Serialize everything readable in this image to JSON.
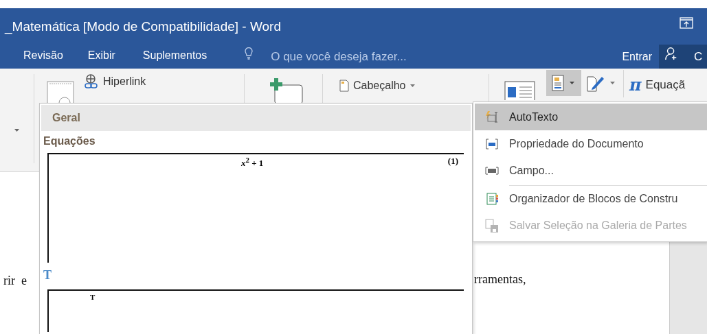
{
  "window": {
    "title": "_Matemática [Modo de Compatibilidade] - Word"
  },
  "tabs": [
    {
      "label": "Revisão",
      "selected": false
    },
    {
      "label": "Exibir",
      "selected": false
    },
    {
      "label": "Suplementos",
      "selected": false
    }
  ],
  "tell_me": {
    "placeholder": "O que você deseja fazer..."
  },
  "account": {
    "sign_in": "Entrar",
    "share": "C"
  },
  "ribbon": {
    "hyperlink": "Hiperlink",
    "header": "Cabeçalho",
    "quick_parts_pressed": true,
    "equation_glyph": "π",
    "equation": "Equaçã"
  },
  "document": {
    "line_start": "rir  e",
    "line_end": "rramentas,"
  },
  "gallery": {
    "header": "Geral",
    "sections": [
      {
        "title": "Equações",
        "preview": "*x*$^{2}$ + 1",
        "number": "(1)"
      },
      {
        "title": "T",
        "preview": "T"
      }
    ]
  },
  "menu": {
    "items": [
      {
        "kind": "autotext",
        "label": "AutoTexto",
        "selected": true,
        "disabled": false,
        "separator_before": false
      },
      {
        "kind": "property",
        "label": "Propriedade do Documento",
        "selected": false,
        "disabled": false,
        "separator_before": false
      },
      {
        "kind": "field",
        "label": "Campo...",
        "selected": false,
        "disabled": false,
        "separator_before": false
      },
      {
        "kind": "organizer",
        "label": "Organizador de Blocos de Constru",
        "selected": false,
        "disabled": false,
        "separator_before": true
      },
      {
        "kind": "save",
        "label": "Salvar Seleção na Galeria de Partes",
        "selected": false,
        "disabled": true,
        "separator_before": false
      }
    ]
  }
}
